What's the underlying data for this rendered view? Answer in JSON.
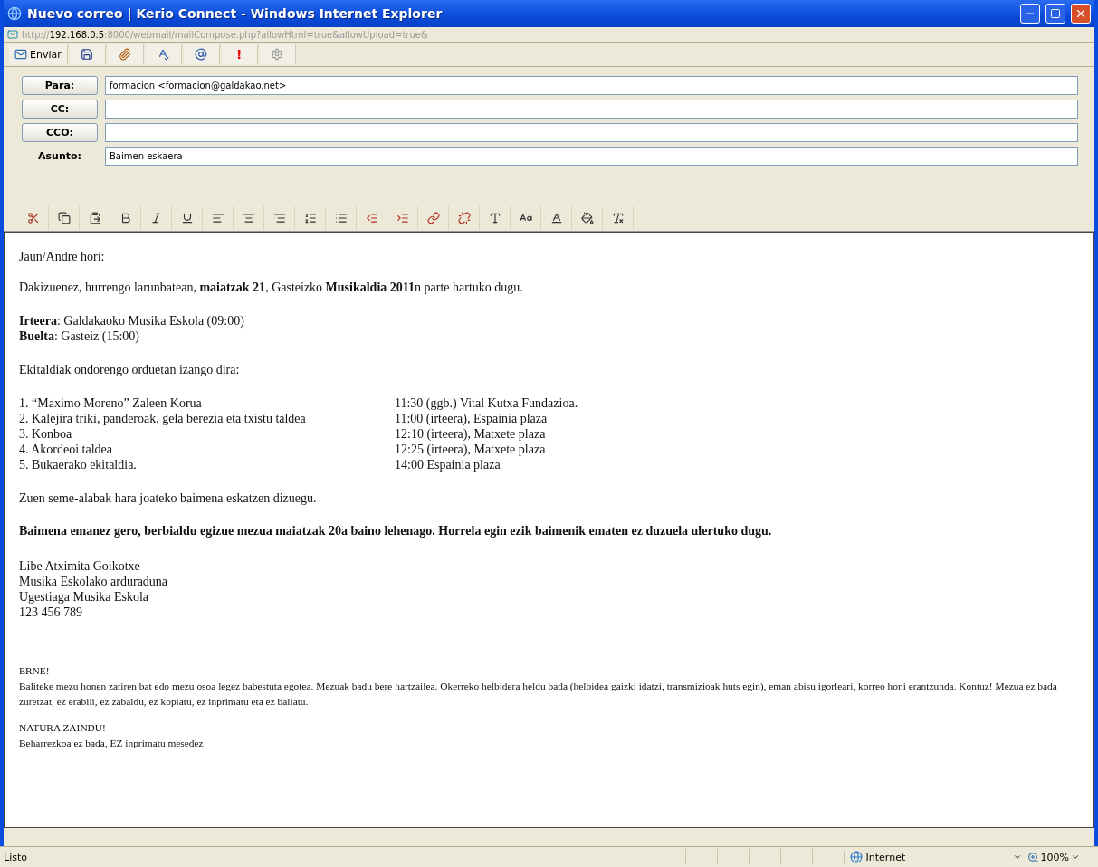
{
  "window": {
    "title": "Nuevo correo | Kerio Connect - Windows Internet Explorer"
  },
  "address": {
    "scheme": "http://",
    "host": "192.168.0.5",
    "rest": ":8000/webmail/mailCompose.php?allowHtml=true&allowUpload=true&"
  },
  "toolbar": {
    "send_label": "Enviar",
    "priority_label": "!"
  },
  "fields": [
    {
      "kind": "button",
      "label": "Para:",
      "value": "formacion <formacion@galdakao.net>"
    },
    {
      "kind": "button",
      "label": "CC:"
    },
    {
      "kind": "button",
      "label": "CCO:"
    },
    {
      "kind": "label",
      "label": "Asunto:",
      "value": "Baimen eskaera"
    }
  ],
  "body": {
    "greeting": "Jaun/Andre hori:",
    "intro": "Dakizuenez, hurrengo larunbatean, **maiatzak 21**, Gasteizko **Musikaldia 2011**n parte hartuko dugu.",
    "trip": [
      "**Irteera**: Galdakaoko Musika Eskola (09:00)",
      "**Buelta**: Gasteiz (15:00)"
    ],
    "events_intro": "Ekitaldiak ondorengo orduetan izango dira:",
    "events": [
      {
        "name": "1. “Maximo Moreno” Zaleen Korua",
        "time": "11:30 (ggb.) Vital Kutxa Fundazioa."
      },
      {
        "name": "2. Kalejira triki, panderoak, gela berezia eta txistu taldea",
        "time": "11:00 (irteera), Espainia plaza"
      },
      {
        "name": "3. Konboa",
        "time": "12:10 (irteera), Matxete  plaza"
      },
      {
        "name": "4. Akordeoi taldea",
        "time": "12:25 (irteera), Matxete  plaza"
      },
      {
        "name": "5. Bukaerako ekitaldia.",
        "time": "14:00 Espainia plaza"
      }
    ],
    "request": "Zuen seme-alabak hara joateko baimena eskatzen dizuegu.",
    "notice": "Baimena emanez gero, berbialdu egizue mezua maiatzak 20a baino lehenago. Horrela egin ezik baimenik ematen ez duzuela ulertuko dugu.",
    "signature": [
      "Libe Atximita Goikotxe",
      "Musika Eskolako arduraduna",
      "Ugestiaga Musika Eskola",
      "123 456 789"
    ],
    "disclaimer": [
      {
        "title": "ERNE!",
        "text": "Baliteke mezu honen zatiren bat edo mezu osoa legez babestuta egotea. Mezuak badu bere hartzailea. Okerreko helbidera heldu bada (helbidea gaizki idatzi, transmizioak huts egin), eman abisu igorleari, korreo honi erantzunda. Kontuz! Mezua ez bada zuretzat, ez erabili, ez zabaldu, ez kopiatu, ez inprimatu eta ez baliatu."
      },
      {
        "title": "NATURA ZAINDU!",
        "text": "Beharrezkoa ez bada, EZ inprimatu mesedez"
      }
    ]
  },
  "status_bar": {
    "status": "Listo",
    "zone": "Internet",
    "zoom": "100%"
  }
}
